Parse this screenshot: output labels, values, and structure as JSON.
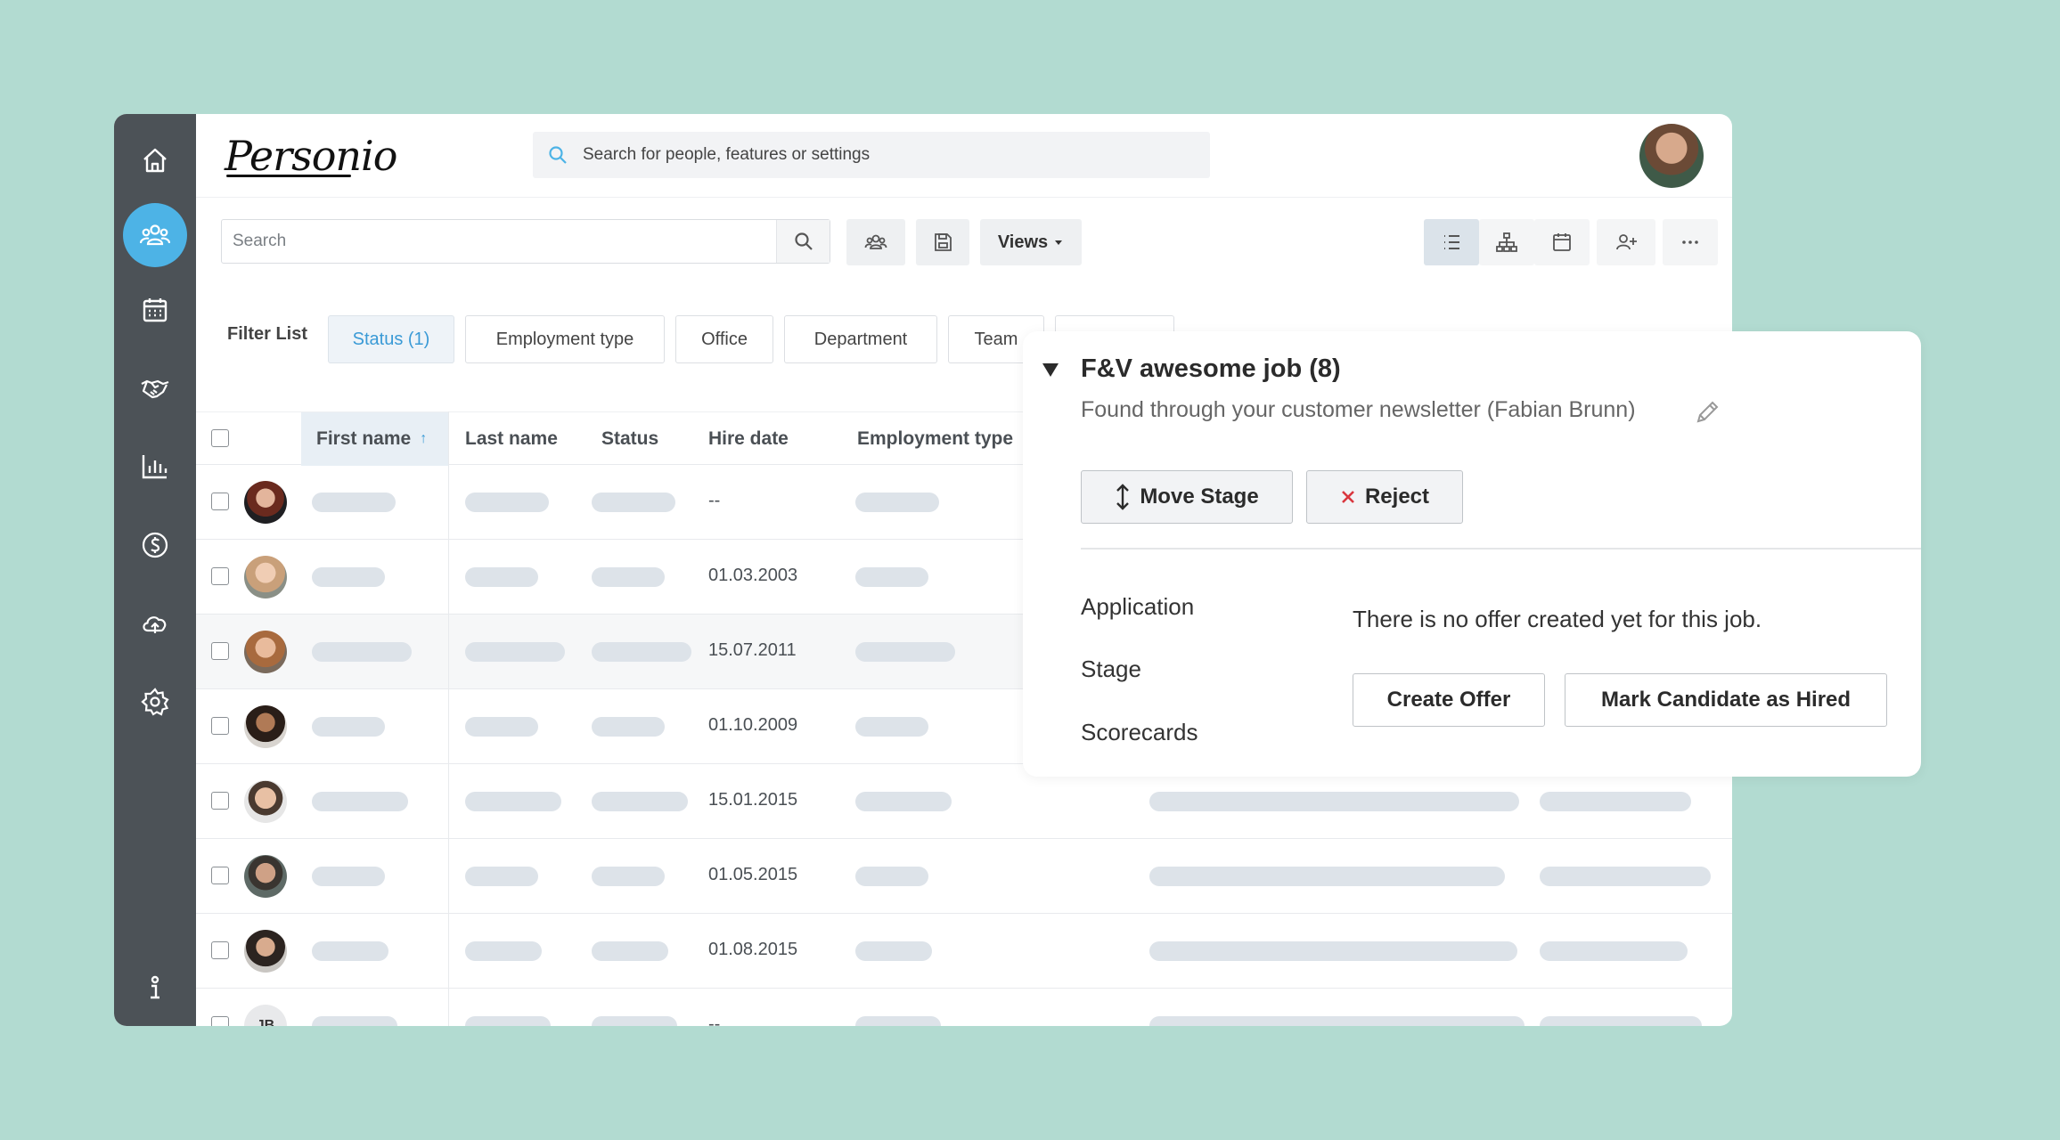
{
  "sidebar": {
    "items": [
      {
        "icon": "home-icon"
      },
      {
        "icon": "people-icon",
        "active": true
      },
      {
        "icon": "calendar-icon"
      },
      {
        "icon": "handshake-icon"
      },
      {
        "icon": "bar-chart-icon"
      },
      {
        "icon": "dollar-icon"
      },
      {
        "icon": "cloud-upload-icon"
      },
      {
        "icon": "gear-icon"
      },
      {
        "icon": "info-icon"
      }
    ]
  },
  "header": {
    "logo": "Personio",
    "search_placeholder": "Search for people, features or settings"
  },
  "toolbar": {
    "search_placeholder": "Search",
    "views_label": "Views"
  },
  "filters": {
    "label": "Filter List",
    "chips": [
      "Status (1)",
      "Employment type",
      "Office",
      "Department",
      "Team"
    ]
  },
  "table": {
    "columns": [
      "First name",
      "Last name",
      "Status",
      "Hire date",
      "Employment type"
    ],
    "rows": [
      {
        "hire_date": "--"
      },
      {
        "hire_date": "01.03.2003"
      },
      {
        "hire_date": "15.07.2011"
      },
      {
        "hire_date": "01.10.2009"
      },
      {
        "hire_date": "15.01.2015"
      },
      {
        "hire_date": "01.05.2015"
      },
      {
        "hire_date": "01.08.2015"
      },
      {
        "hire_date": "--",
        "initials": "JB"
      }
    ]
  },
  "panel": {
    "title": "F&V awesome job (8)",
    "subtitle": "Found through your customer newsletter (Fabian Brunn)",
    "move_stage": "Move Stage",
    "reject": "Reject",
    "links": [
      "Application",
      "Stage",
      "Scorecards"
    ],
    "no_offer_text": "There is no offer created yet for this job.",
    "create_offer": "Create Offer",
    "mark_hired": "Mark Candidate as Hired"
  },
  "colors": {
    "background": "#b2dbd1",
    "sidebar": "#4c5257",
    "accent": "#4db3e6",
    "link_blue": "#3a9ad6",
    "reject_red": "#d9363e"
  }
}
